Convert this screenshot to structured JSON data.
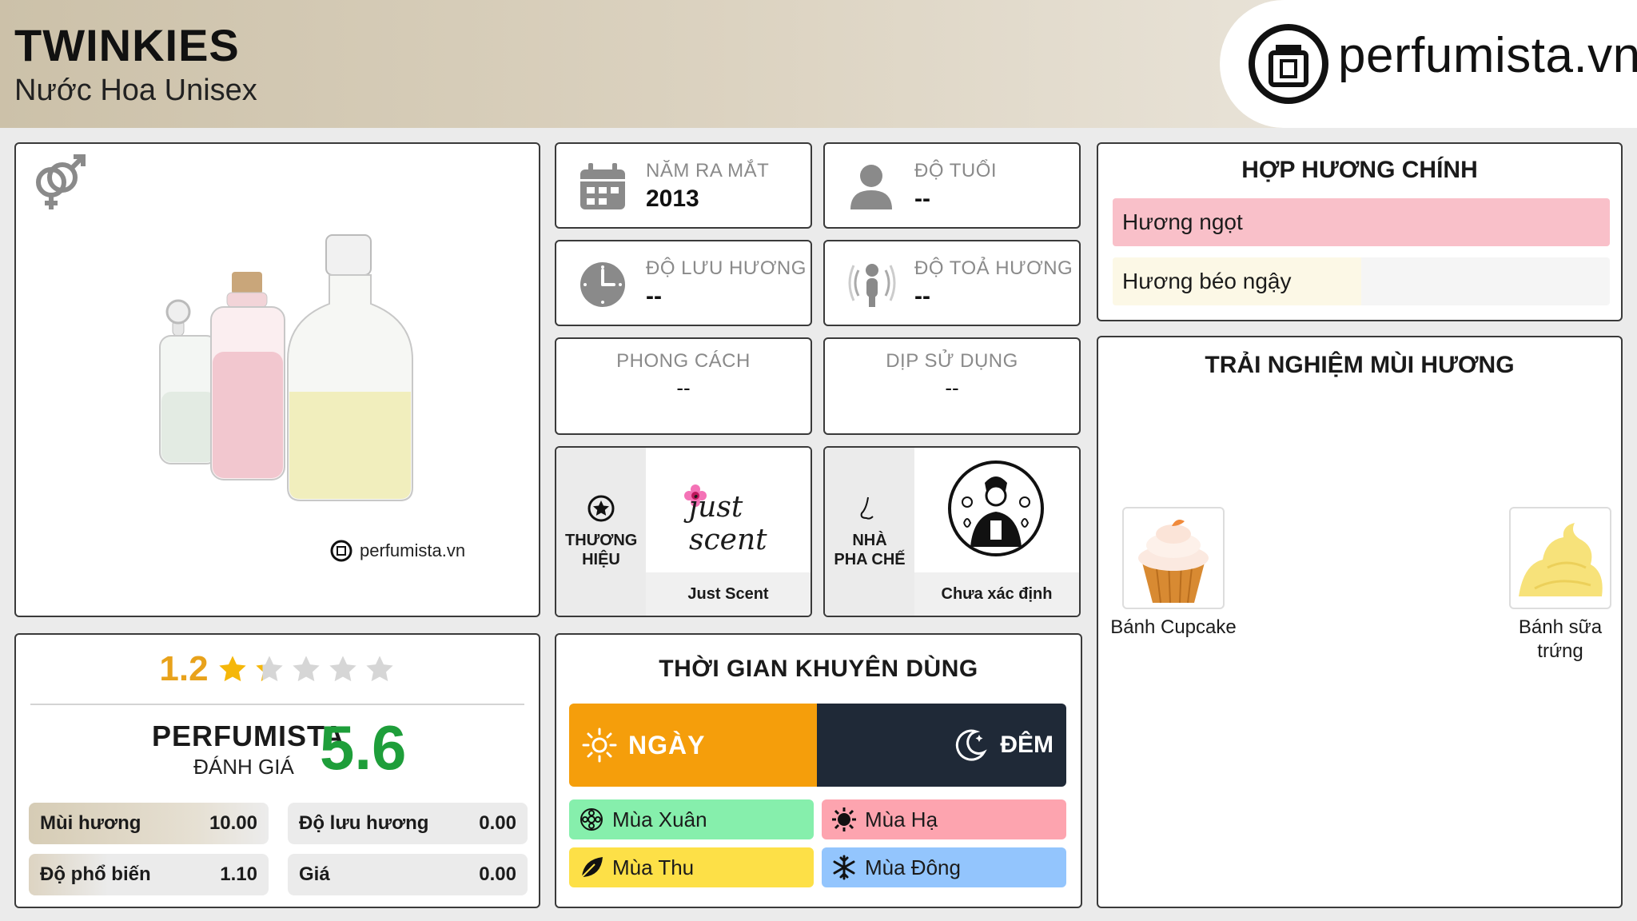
{
  "header": {
    "title": "TWINKIES",
    "subtitle": "Nước Hoa Unisex",
    "logo_text": "perfumista.vn"
  },
  "product": {
    "gender_icon": "unisex-gender-icon",
    "watermark": "perfumista.vn"
  },
  "rating": {
    "user_score": "1.2",
    "user_stars_fraction": 0.24,
    "perfumista_title": "PERFUMISTA",
    "perfumista_sub": "ĐÁNH GIÁ",
    "perfumista_score": "5.6",
    "metrics": [
      {
        "label": "Mùi hương",
        "value": "10.00",
        "level": 1.0
      },
      {
        "label": "Độ lưu hương",
        "value": "0.00",
        "level": 0.0
      },
      {
        "label": "Độ phổ biến",
        "value": "1.10",
        "level": 0.11
      },
      {
        "label": "Giá",
        "value": "0.00",
        "level": 0.0
      }
    ]
  },
  "info": {
    "launch": {
      "label": "NĂM RA MẮT",
      "value": "2013"
    },
    "age": {
      "label": "ĐỘ TUỔI",
      "value": "--"
    },
    "longevity": {
      "label": "ĐỘ LƯU HƯƠNG",
      "value": "--"
    },
    "sillage": {
      "label": "ĐỘ TOẢ HƯƠNG",
      "value": "--"
    },
    "style": {
      "label": "PHONG CÁCH",
      "value": "--"
    },
    "occasion": {
      "label": "DỊP SỬ DỤNG",
      "value": "--"
    },
    "brand": {
      "label": "THƯƠNG HIỆU",
      "logo_text": "just scent",
      "name": "Just Scent"
    },
    "perfumer": {
      "label": "NHÀ PHA CHẾ",
      "name": "Chưa xác định"
    }
  },
  "time": {
    "title": "THỜI GIAN KHUYÊN DÙNG",
    "day": "NGÀY",
    "night": "ĐÊM",
    "seasons": [
      {
        "label": "Mùa Xuân",
        "color": "#86efac"
      },
      {
        "label": "Mùa Hạ",
        "color": "#fda4af"
      },
      {
        "label": "Mùa Thu",
        "color": "#fde047"
      },
      {
        "label": "Mùa Đông",
        "color": "#93c5fd"
      }
    ]
  },
  "accords": {
    "title": "HỢP HƯƠNG CHÍNH",
    "items": [
      {
        "label": "Hương ngọt",
        "level": 1.0,
        "color": "#f9c0c9"
      },
      {
        "label": "Hương béo ngậy",
        "level": 0.5,
        "color": "#fcf8e6"
      }
    ]
  },
  "experience": {
    "title": "TRẢI NGHIỆM MÙI HƯƠNG",
    "notes": [
      {
        "label": "Bánh Cupcake"
      },
      {
        "label": "Bánh sữa trứng"
      }
    ]
  }
}
